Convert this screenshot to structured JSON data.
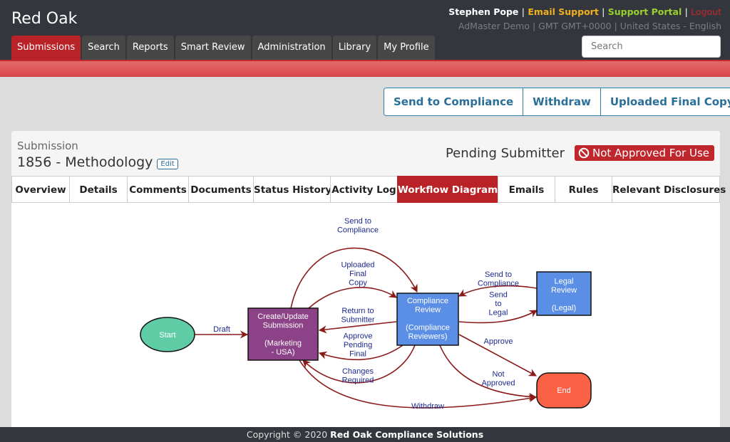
{
  "app": {
    "brand": "Red Oak"
  },
  "nav": {
    "tabs": [
      {
        "label": "Submissions",
        "active": true
      },
      {
        "label": "Search"
      },
      {
        "label": "Reports"
      },
      {
        "label": "Smart Review"
      },
      {
        "label": "Administration"
      },
      {
        "label": "Library"
      },
      {
        "label": "My Profile"
      }
    ]
  },
  "user": {
    "name": "Stephen Pope",
    "email_support": "Email Support",
    "support_portal": "Support Portal",
    "logout": "Logout",
    "separator": "|",
    "meta": "AdMaster Demo | GMT GMT+0000 | United States - English"
  },
  "search": {
    "placeholder": "Search"
  },
  "actions": [
    "Send to Compliance",
    "Withdraw",
    "Uploaded Final Copy"
  ],
  "submission": {
    "label": "Submission",
    "title": "1856 - Methodology",
    "edit_label": "Edit",
    "status": "Pending Submitter",
    "approval_badge": "Not Approved For Use",
    "badge_icon": "ban-icon"
  },
  "tabs": [
    {
      "label": "Overview"
    },
    {
      "label": "Details"
    },
    {
      "label": "Comments"
    },
    {
      "label": "Documents"
    },
    {
      "label": "Status History"
    },
    {
      "label": "Activity Log"
    },
    {
      "label": "Workflow Diagram",
      "active": true
    },
    {
      "label": "Emails"
    },
    {
      "label": "Rules"
    },
    {
      "label": "Relevant Disclosures"
    }
  ],
  "workflow": {
    "nodes": {
      "start": {
        "lines": [
          "Start"
        ],
        "color": "#5fcca6"
      },
      "create": {
        "lines": [
          "Create/Update",
          "Submission",
          "",
          "(Marketing",
          "- USA)"
        ],
        "color": "#8c4287"
      },
      "compliance": {
        "lines": [
          "Compliance",
          "Review",
          "",
          "(Compliance",
          "Reviewers)"
        ],
        "color": "#5b8fe6"
      },
      "legal": {
        "lines": [
          "Legal",
          "Review",
          "",
          "(Legal)"
        ],
        "color": "#5b8fe6"
      },
      "end": {
        "lines": [
          "End"
        ],
        "color": "#fb6145"
      }
    },
    "edges": [
      {
        "from": "start",
        "to": "create",
        "label": [
          "Draft"
        ]
      },
      {
        "from": "create",
        "to": "compliance",
        "label": [
          "Send to",
          "Compliance"
        ]
      },
      {
        "from": "create",
        "to": "compliance",
        "label": [
          "Uploaded",
          "Final",
          "Copy"
        ]
      },
      {
        "from": "compliance",
        "to": "create",
        "label": [
          "Return to",
          "Submitter"
        ]
      },
      {
        "from": "compliance",
        "to": "create",
        "label": [
          "Approve",
          "Pending",
          "Final"
        ]
      },
      {
        "from": "compliance",
        "to": "create",
        "label": [
          "Changes",
          "Required"
        ]
      },
      {
        "from": "legal",
        "to": "compliance",
        "label": [
          "Send to",
          "Compliance"
        ]
      },
      {
        "from": "compliance",
        "to": "legal",
        "label": [
          "Send",
          "to",
          "Legal"
        ]
      },
      {
        "from": "compliance",
        "to": "end",
        "label": [
          "Approve"
        ]
      },
      {
        "from": "compliance",
        "to": "end",
        "label": [
          "Not",
          "Approved"
        ]
      },
      {
        "from": "create",
        "to": "end",
        "label": [
          "Withdraw"
        ]
      }
    ],
    "edge_color": "#8b1a1a",
    "label_color": "#1c2a8c"
  },
  "footer": {
    "prefix": "Copyright © 2020",
    "company": "Red Oak Compliance Solutions"
  }
}
